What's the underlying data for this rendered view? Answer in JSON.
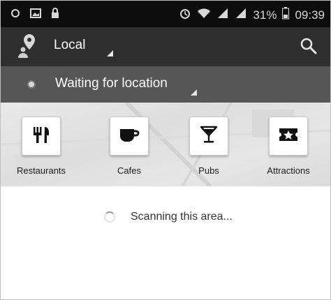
{
  "status_bar": {
    "battery_percent": "31%",
    "time": "09:39",
    "icons": [
      "location-ring-icon",
      "image-icon",
      "lock-icon",
      "alarm-icon",
      "wifi-icon",
      "signal-icon",
      "signal-icon",
      "battery-icon"
    ]
  },
  "action_bar": {
    "spinner_label": "Local",
    "search_icon": "search-icon",
    "app_icon": "map-pin-person-icon"
  },
  "location_bar": {
    "text": "Waiting for location"
  },
  "categories": [
    {
      "label": "Restaurants",
      "icon": "fork-knife-icon"
    },
    {
      "label": "Cafes",
      "icon": "coffee-cup-icon"
    },
    {
      "label": "Pubs",
      "icon": "cocktail-glass-icon"
    },
    {
      "label": "Attractions",
      "icon": "ticket-star-icon"
    }
  ],
  "content": {
    "status_text": "Scanning this area..."
  },
  "colors": {
    "status_bar": "#0d0d0d",
    "action_bar": "#2e2e2e",
    "location_bar": "#565656",
    "categories_bg": "#e4e4e4"
  }
}
